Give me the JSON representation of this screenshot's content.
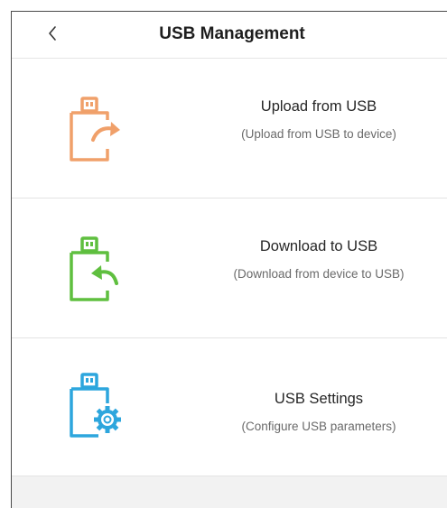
{
  "header": {
    "back_icon": "chevron-left-icon",
    "title": "USB Management"
  },
  "items": [
    {
      "icon": "usb-upload-icon",
      "color": "#f0a06a",
      "title": "Upload from USB",
      "description": "(Upload from USB to device)"
    },
    {
      "icon": "usb-download-icon",
      "color": "#5fbf3f",
      "title": "Download to USB",
      "description": "(Download from device to USB)"
    },
    {
      "icon": "usb-settings-icon",
      "color": "#2da6dd",
      "title": "USB Settings",
      "description": "(Configure USB parameters)"
    }
  ]
}
